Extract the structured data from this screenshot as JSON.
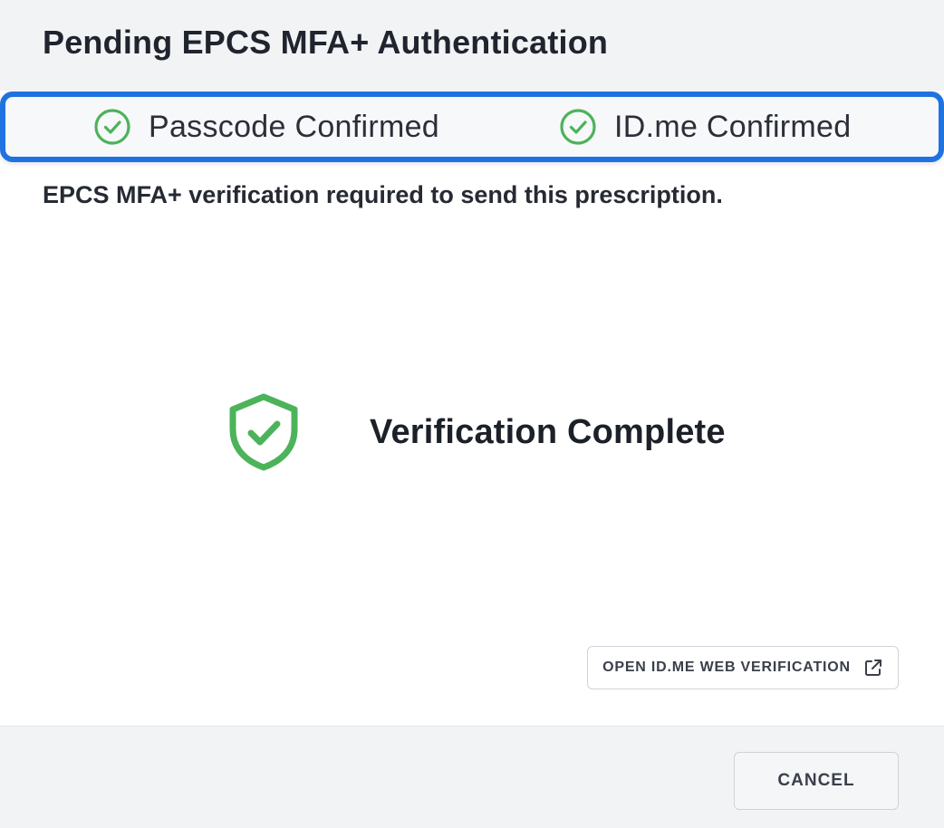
{
  "dialog": {
    "title": "Pending EPCS MFA+ Authentication",
    "status": [
      {
        "label": "Passcode Confirmed",
        "icon": "check-circle-icon",
        "state": "confirmed"
      },
      {
        "label": "ID.me Confirmed",
        "icon": "check-circle-icon",
        "state": "confirmed"
      }
    ],
    "subtitle": "EPCS MFA+ verification required to send this prescription.",
    "verification": {
      "icon": "shield-check-icon",
      "label": "Verification Complete"
    },
    "open_button": {
      "label": "OPEN ID.ME WEB VERIFICATION",
      "icon": "external-link-icon"
    },
    "footer": {
      "cancel_label": "CANCEL"
    }
  },
  "colors": {
    "accent_border": "#1f73e0",
    "success_green": "#4cb35a",
    "header_bg": "#f2f3f5"
  }
}
